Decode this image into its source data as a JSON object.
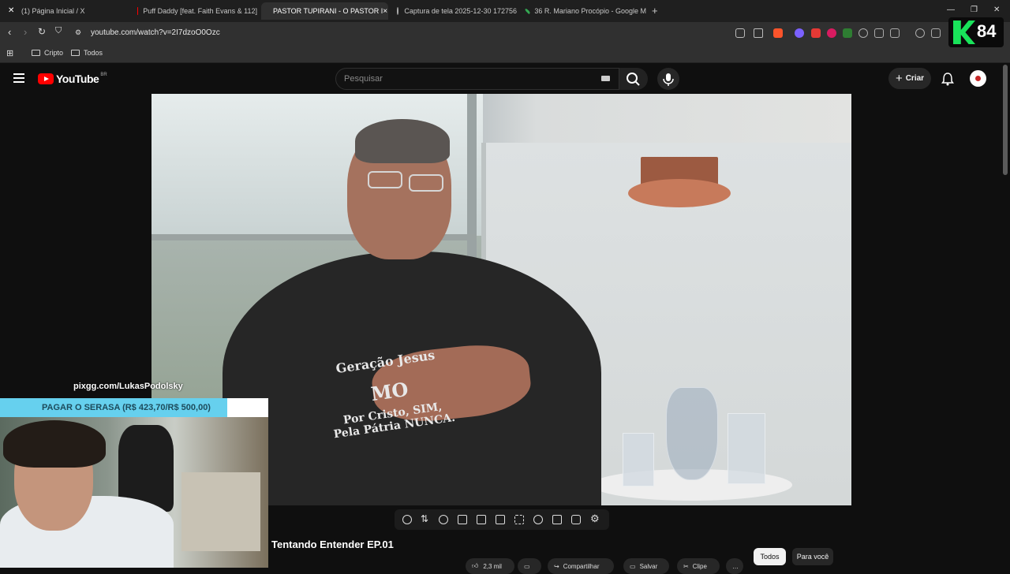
{
  "browser": {
    "tabs": [
      {
        "title": "(1) Página Inicial / X",
        "favicon": "x-logo-icon",
        "active": false
      },
      {
        "title": "Puff Daddy [feat. Faith Evans & 112]",
        "favicon": "youtube-icon",
        "active": false
      },
      {
        "title": "PASTOR TUPIRANI - O PASTOR I",
        "favicon": "youtube-icon",
        "active": true
      },
      {
        "title": "Captura de tela 2025-12-30 172756",
        "favicon": "globe-icon",
        "active": false
      },
      {
        "title": "36 R. Mariano Procópio - Google M",
        "favicon": "maps-pin-icon",
        "active": false
      }
    ],
    "tab_close": "×",
    "new_tab": "+",
    "url": "youtube.com/watch?v=2I7dzoO0Ozc",
    "bookmarks": [
      {
        "label": "Cripto"
      },
      {
        "label": "Todos"
      }
    ],
    "overlay_badge": "84"
  },
  "youtube": {
    "logo_text": "YouTube",
    "region": "BR",
    "search_placeholder": "Pesquisar",
    "create_label": "Criar",
    "create_icon": "+"
  },
  "video": {
    "shirt_text": [
      "Geração Jesus",
      "MO",
      "Por Cristo, SIM,",
      "Pela Pátria NUNCA."
    ]
  },
  "stream_overlay": {
    "donation_url": "pixgg.com/LukasPodolsky",
    "goal_text": "PAGAR O SERASA (R$ 423,70/R$ 500,00)",
    "goal_current": 423.7,
    "goal_target": 500.0
  },
  "below_video": {
    "title": "Tentando Entender EP.01",
    "chips": [
      "Todos",
      "Para você"
    ],
    "actions": [
      "2,3 mil",
      "Compartilhar",
      "Salvar",
      "Clipe"
    ]
  }
}
